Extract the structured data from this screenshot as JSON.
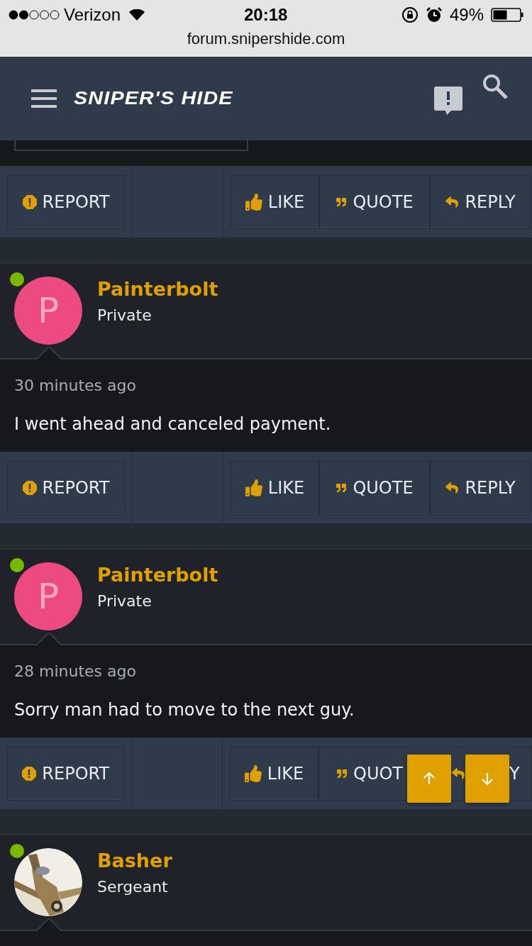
{
  "status_bar": {
    "carrier": "Verizon",
    "time": "20:18",
    "battery": "49%",
    "url": "forum.snipershide.com"
  },
  "header": {
    "logo": "SNIPER'S HIDE"
  },
  "posts": [
    {
      "actions": [
        {
          "kind": "report",
          "label": "REPORT"
        },
        {
          "kind": "like",
          "label": "LIKE"
        },
        {
          "kind": "quote",
          "label": "QUOTE"
        },
        {
          "kind": "reply",
          "label": "REPLY"
        }
      ]
    },
    {
      "author": "Painterbolt",
      "rank": "Private",
      "online": true,
      "avatar": {
        "kind": "letter",
        "letter": "P",
        "color": "#ec4a80"
      },
      "time": "30 minutes ago",
      "text": "I went ahead and canceled payment.",
      "actions": [
        {
          "kind": "report",
          "label": "REPORT"
        },
        {
          "kind": "like",
          "label": "LIKE"
        },
        {
          "kind": "quote",
          "label": "QUOTE"
        },
        {
          "kind": "reply",
          "label": "REPLY"
        }
      ]
    },
    {
      "author": "Painterbolt",
      "rank": "Private",
      "online": true,
      "avatar": {
        "kind": "letter",
        "letter": "P",
        "color": "#ec4a80"
      },
      "time": "28 minutes ago",
      "text": "Sorry man had to move to the next guy.",
      "actions": [
        {
          "kind": "report",
          "label": "REPORT"
        },
        {
          "kind": "like",
          "label": "LIKE"
        },
        {
          "kind": "quote",
          "label": "QUOT"
        },
        {
          "kind": "reply",
          "label": "Y"
        }
      ]
    },
    {
      "author": "Basher",
      "rank": "Sergeant",
      "online": true
    }
  ]
}
